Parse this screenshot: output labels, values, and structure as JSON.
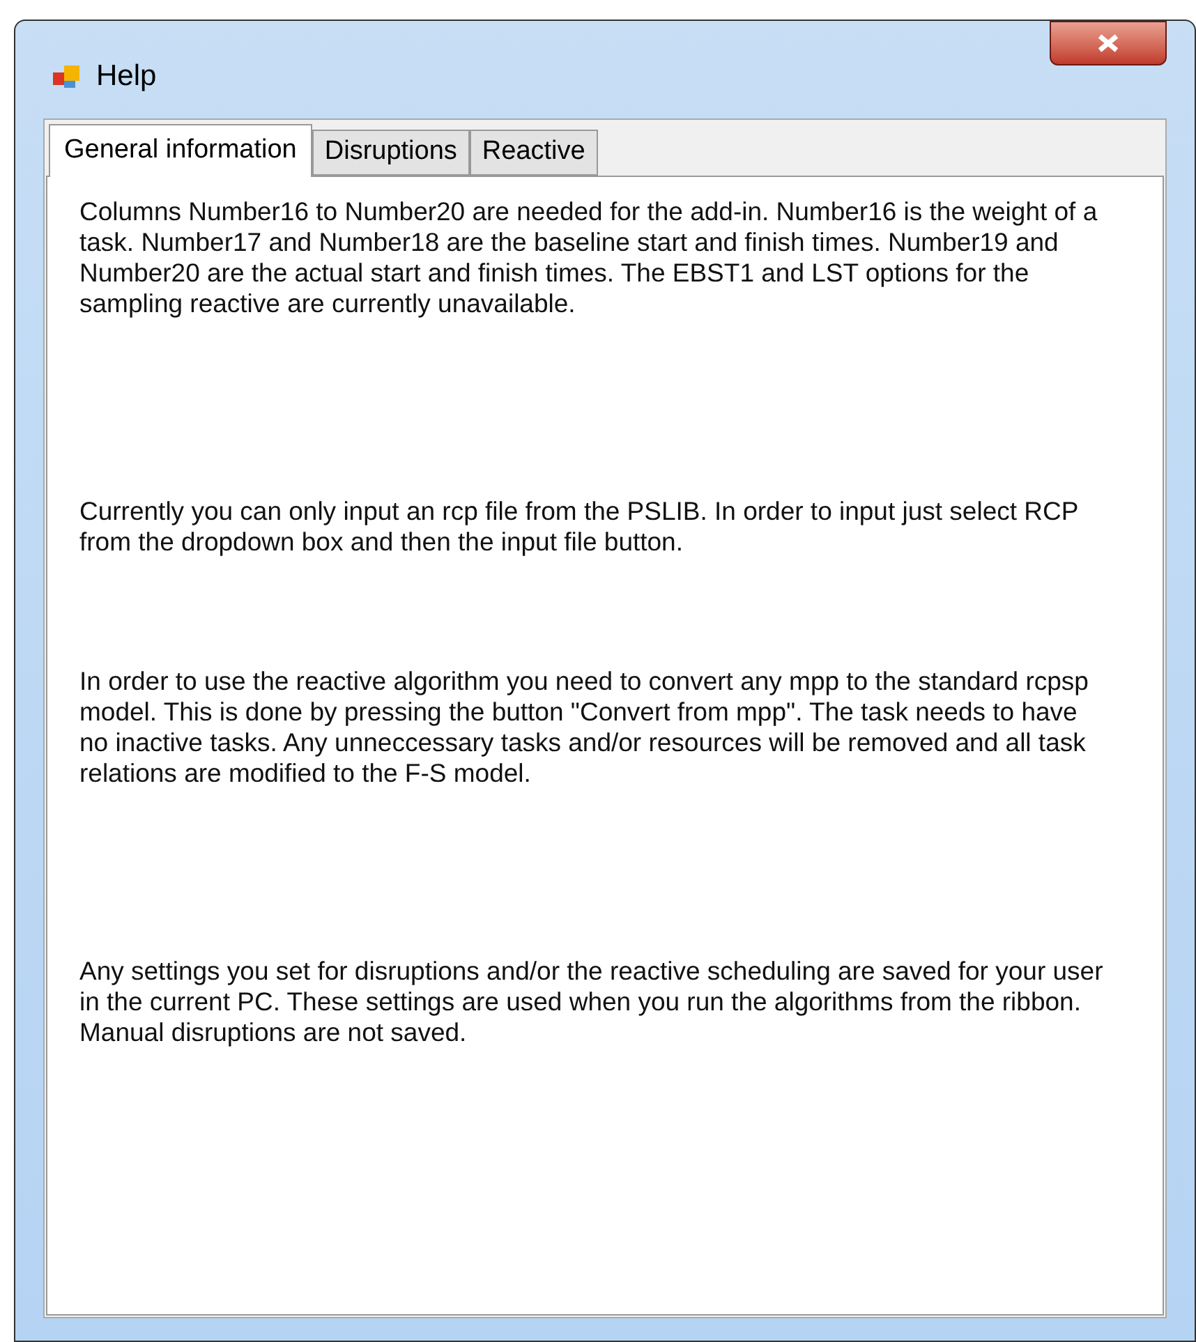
{
  "window": {
    "title": "Help"
  },
  "tabs": [
    {
      "label": "General information",
      "selected": true
    },
    {
      "label": "Disruptions",
      "selected": false
    },
    {
      "label": "Reactive",
      "selected": false
    }
  ],
  "paragraphs": [
    "Columns Number16 to Number20 are needed for the add-in. Number16 is the weight of a task. Number17 and Number18 are the baseline start and finish times. Number19 and Number20 are the actual start and finish times. The EBST1 and LST options for the sampling reactive are currently unavailable.",
    "Currently you can only input an rcp file from the PSLIB. In order to input just select RCP from the dropdown box and then the input file button.",
    "In order to use the reactive algorithm you need to convert any mpp to the standard rcpsp model. This is done by pressing the button \"Convert from mpp\". The task needs to have no inactive tasks. Any unneccessary tasks and/or resources will be removed and all task relations are modified to the F-S model.",
    "Any settings you set for disruptions and/or the reactive scheduling are saved for your user in the current PC. These settings are used when you run the algorithms from the ribbon. Manual disruptions are not saved."
  ]
}
